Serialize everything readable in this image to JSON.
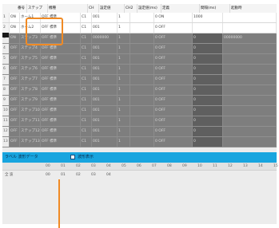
{
  "table": {
    "headers": [
      "番号",
      "ステップ",
      "機種",
      "CH",
      "設定値",
      "CH2",
      "設定値(ms)",
      "定義",
      "間隔(ms)",
      "起動時"
    ],
    "rows": [
      {
        "num": "1",
        "status": "ON",
        "step": "ホーム1",
        "type": "OFF 標準",
        "ch": "C1",
        "val": "001",
        "ch2": "1",
        "x": "",
        "def": "0 ON",
        "interval": "1000",
        "start": "",
        "kind": "light"
      },
      {
        "num": "2",
        "status": "ON",
        "step": "ホーム2",
        "type": "OFF 標準",
        "ch": "C1",
        "val": "001",
        "ch2": "1",
        "x": "",
        "def": "0 OFF",
        "interval": "",
        "start": "",
        "kind": "light"
      },
      {
        "num": "3",
        "status": "ON",
        "step": "ステップ3",
        "type": "OFF 標準",
        "ch": "C1",
        "val": "0000000",
        "ch2": "1",
        "x": "",
        "def": "0 OFF",
        "interval": "0",
        "start": "00000000",
        "kind": "dark"
      },
      {
        "num": "4",
        "status": "OFF",
        "step": "ステップ4",
        "type": "OFF 標準",
        "ch": "C1",
        "val": "001",
        "ch2": "1",
        "x": "",
        "def": "0 OFF",
        "interval": "0",
        "start": "",
        "kind": "dark"
      },
      {
        "num": "5",
        "status": "OFF",
        "step": "ステップ5",
        "type": "OFF 標準",
        "ch": "C1",
        "val": "001",
        "ch2": "1",
        "x": "",
        "def": "0 OFF",
        "interval": "0",
        "start": "",
        "kind": "dark"
      },
      {
        "num": "6",
        "status": "OFF",
        "step": "ステップ6",
        "type": "OFF 標準",
        "ch": "C1",
        "val": "001",
        "ch2": "1",
        "x": "",
        "def": "0 OFF",
        "interval": "0",
        "start": "",
        "kind": "dark"
      },
      {
        "num": "7",
        "status": "OFF",
        "step": "ステップ7",
        "type": "OFF 標準",
        "ch": "C1",
        "val": "001",
        "ch2": "1",
        "x": "",
        "def": "0 OFF",
        "interval": "0",
        "start": "",
        "kind": "dark"
      },
      {
        "num": "8",
        "status": "OFF",
        "step": "ステップ8",
        "type": "OFF 標準",
        "ch": "C1",
        "val": "001",
        "ch2": "1",
        "x": "",
        "def": "0 OFF",
        "interval": "0",
        "start": "",
        "kind": "dark"
      },
      {
        "num": "9",
        "status": "OFF",
        "step": "ステップ9",
        "type": "OFF 標準",
        "ch": "C1",
        "val": "001",
        "ch2": "1",
        "x": "",
        "def": "0 OFF",
        "interval": "0",
        "start": "",
        "kind": "dark"
      },
      {
        "num": "10",
        "status": "OFF",
        "step": "ステップ10",
        "type": "OFF 標準",
        "ch": "C1",
        "val": "001",
        "ch2": "1",
        "x": "",
        "def": "0 OFF",
        "interval": "0",
        "start": "",
        "kind": "dark"
      },
      {
        "num": "11",
        "status": "OFF",
        "step": "ステップ11",
        "type": "OFF 標準",
        "ch": "C1",
        "val": "001",
        "ch2": "1",
        "x": "",
        "def": "0 OFF",
        "interval": "0",
        "start": "",
        "kind": "dark"
      },
      {
        "num": "12",
        "status": "OFF",
        "step": "ステップ12",
        "type": "OFF 標準",
        "ch": "C1",
        "val": "001",
        "ch2": "1",
        "x": "",
        "def": "0 OFF",
        "interval": "0",
        "start": "",
        "kind": "dark"
      },
      {
        "num": "13",
        "status": "OFF",
        "step": "ステップ13",
        "type": "OFF 標準",
        "ch": "C1",
        "val": "001",
        "ch2": "1",
        "x": "",
        "def": "0 OFF",
        "interval": "0",
        "start": "",
        "kind": "dark"
      }
    ]
  },
  "bar": {
    "left_label": "ラベル 波形データ",
    "checkbox_label": "波形表示"
  },
  "timeline": {
    "header_numbers": [
      "00",
      "01",
      "02",
      "03",
      "04",
      "05",
      "06",
      "07",
      "08",
      "09",
      "10",
      "11",
      "12",
      "13",
      "14",
      "15"
    ],
    "row_label": "全 波",
    "row_values": [
      "00",
      "01",
      "02",
      "03",
      "04"
    ]
  },
  "colors": {
    "highlight": "#f08a24",
    "bar": "#18a5df"
  }
}
